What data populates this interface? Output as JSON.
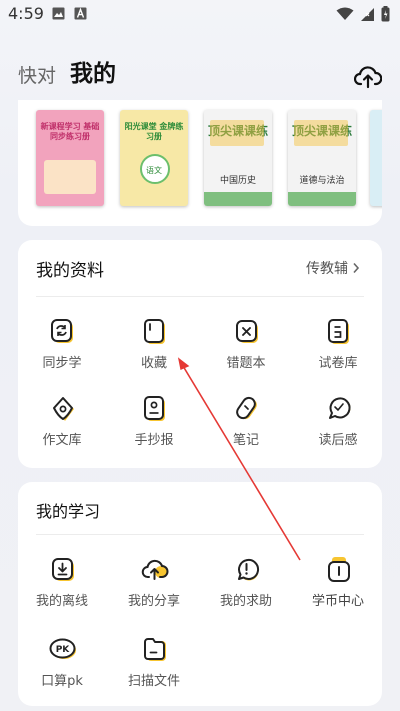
{
  "status": {
    "time": "4:59"
  },
  "header": {
    "tab_inactive": "快对",
    "tab_active": "我的"
  },
  "books": [
    {
      "title": "新课程学习 基础同步练习册",
      "sub": "",
      "color": "#f0a0b8"
    },
    {
      "title": "阳光课堂 金牌练习册",
      "sub": "语文",
      "color": "#f6e7a4"
    },
    {
      "title": "顶尖课课练",
      "sub": "中国历史",
      "color": "#f2f2f2"
    },
    {
      "title": "顶尖课课练",
      "sub": "道德与法治",
      "color": "#f2f2f2"
    }
  ],
  "materials": {
    "title": "我的资料",
    "link": "传教辅",
    "items": [
      {
        "label": "同步学",
        "icon": "sync-icon"
      },
      {
        "label": "收藏",
        "icon": "bookmark-icon"
      },
      {
        "label": "错题本",
        "icon": "wrong-book-icon"
      },
      {
        "label": "试卷库",
        "icon": "exam-icon"
      },
      {
        "label": "作文库",
        "icon": "pen-nib-icon"
      },
      {
        "label": "手抄报",
        "icon": "poster-icon"
      },
      {
        "label": "笔记",
        "icon": "note-icon"
      },
      {
        "label": "读后感",
        "icon": "reading-icon"
      }
    ]
  },
  "study": {
    "title": "我的学习",
    "items": [
      {
        "label": "我的离线",
        "icon": "download-icon"
      },
      {
        "label": "我的分享",
        "icon": "share-upload-icon"
      },
      {
        "label": "我的求助",
        "icon": "help-icon"
      },
      {
        "label": "学币中心",
        "icon": "coin-icon"
      },
      {
        "label": "口算pk",
        "icon": "pk-icon",
        "icon_text": "PK"
      },
      {
        "label": "扫描文件",
        "icon": "scan-file-icon"
      }
    ]
  },
  "colors": {
    "accent": "#f7c531",
    "stroke": "#222222",
    "annotation": "#e53935"
  }
}
